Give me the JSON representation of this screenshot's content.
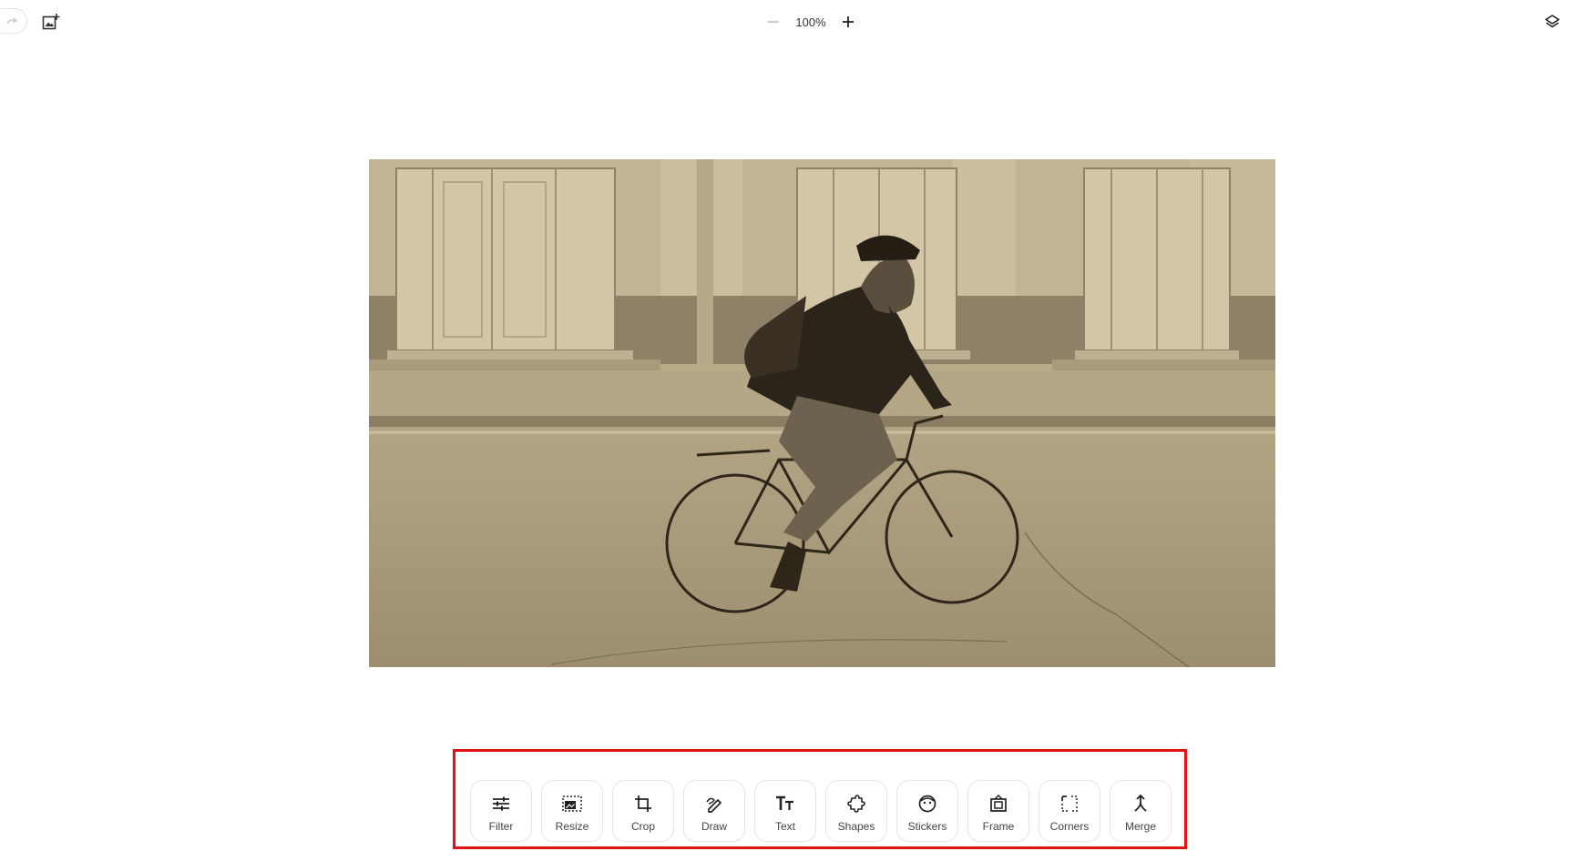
{
  "topbar": {
    "redo_icon": "redo-icon",
    "add_image_icon": "add-image-icon",
    "zoom": {
      "value": "100%",
      "minus_icon": "minus-icon",
      "plus_icon": "plus-icon"
    },
    "layers_icon": "layers-icon"
  },
  "canvas": {
    "tone": "sepia",
    "colors": {
      "wall_light": "#c7b99a",
      "wall_dark": "#8f8068",
      "door": "#d6c9ab",
      "door_line": "#a89a7c",
      "sidewalk": "#b2a383",
      "road": "#a89a7a",
      "shadow": "#3a3124"
    }
  },
  "toolbar": {
    "highlight_color": "#e31212",
    "tools": [
      {
        "label": "Filter",
        "icon": "sliders-icon"
      },
      {
        "label": "Resize",
        "icon": "resize-icon"
      },
      {
        "label": "Crop",
        "icon": "crop-icon"
      },
      {
        "label": "Draw",
        "icon": "draw-icon"
      },
      {
        "label": "Text",
        "icon": "text-icon"
      },
      {
        "label": "Shapes",
        "icon": "shapes-icon"
      },
      {
        "label": "Stickers",
        "icon": "sticker-icon"
      },
      {
        "label": "Frame",
        "icon": "frame-icon"
      },
      {
        "label": "Corners",
        "icon": "corners-icon"
      },
      {
        "label": "Merge",
        "icon": "merge-icon"
      }
    ]
  }
}
